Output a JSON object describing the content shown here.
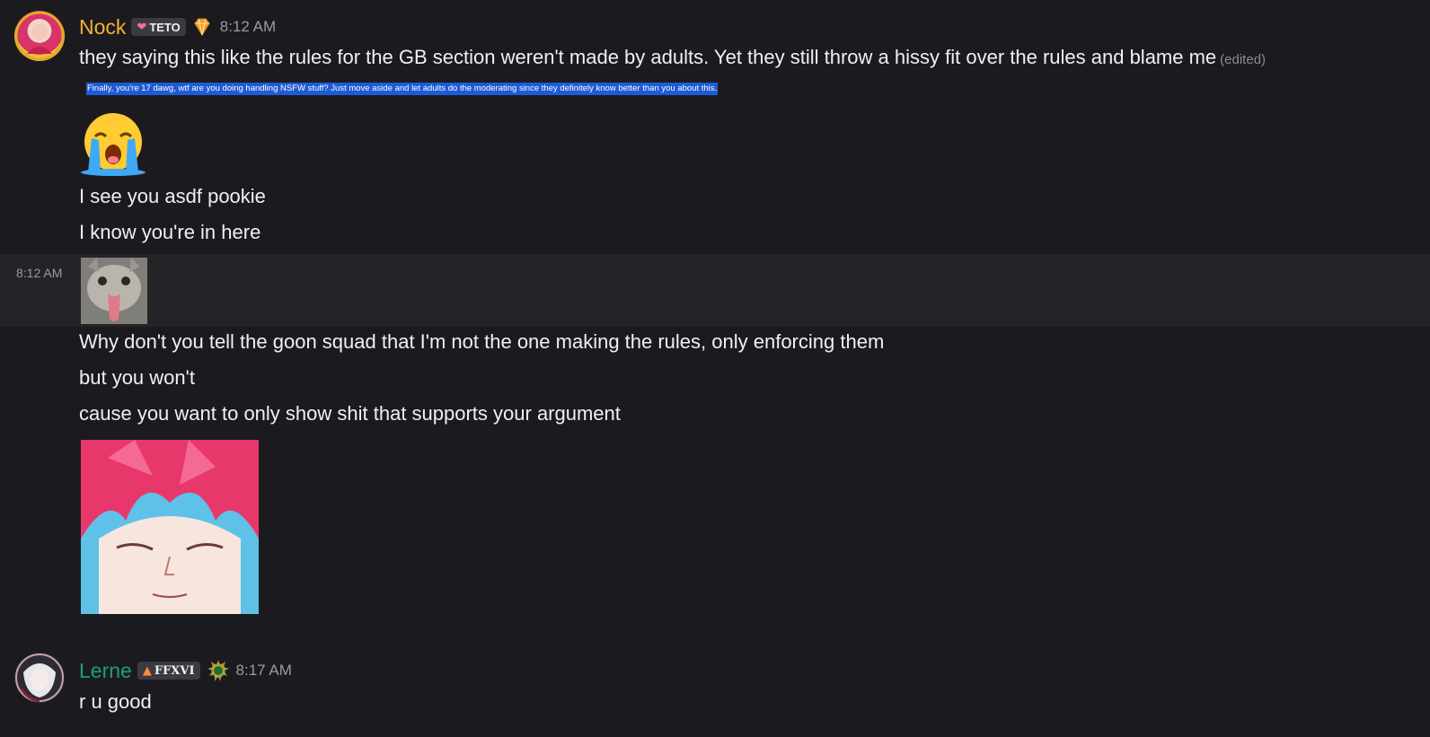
{
  "messages": [
    {
      "author": "Nock",
      "author_color": "#f0b232",
      "role_tag": "TETO",
      "role_tag_icon": "heart-icon",
      "badge_icon": "diamond-icon",
      "timestamp": "8:12 AM",
      "lines": [
        {
          "text": "they saying this like the rules for the GB section weren't made by adults. Yet they still throw a hissy fit over the rules and blame me",
          "edited": "(edited)"
        }
      ],
      "quoted_screenshot_text": "Finally, you're 17 dawg, wtf are you doing handling NSFW stuff? Just move aside and let adults do the moderating since they definitely know better than you about this.",
      "emoji": "loudly-crying-face",
      "more_lines": [
        "I see you asdf pookie",
        "I know you're in here"
      ]
    },
    {
      "hover_timestamp": "8:12 AM",
      "image": "cat-tongue-image",
      "lines": [
        "Why don't you tell the goon squad that I'm not the one making the rules, only enforcing them",
        "but you won't",
        "cause you want to only show shit that supports your argument"
      ],
      "image2": "anime-face-image"
    },
    {
      "author": "Lerne",
      "author_color": "#1f9d7a",
      "role_tag": "FFXVI",
      "role_tag_icon": "flame-icon",
      "badge_icon": "green-emblem-icon",
      "timestamp": "8:17 AM",
      "lines": [
        "r u good"
      ]
    }
  ]
}
